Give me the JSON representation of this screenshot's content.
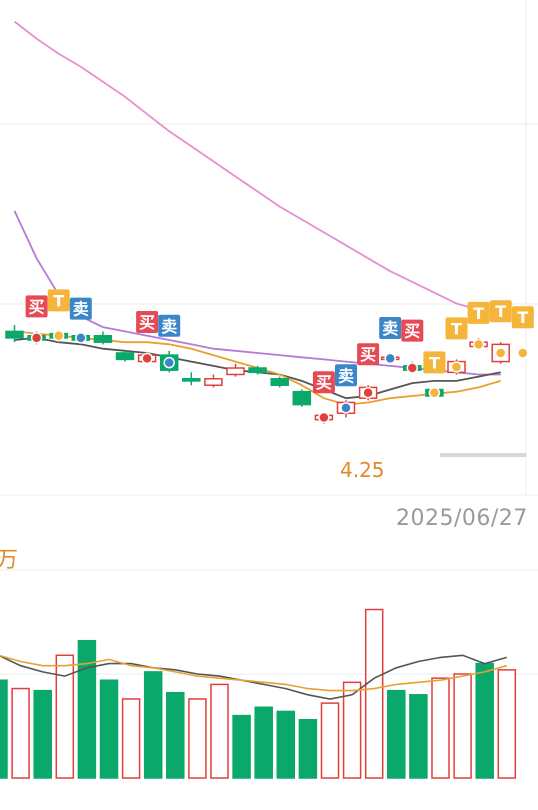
{
  "labels": {
    "date": "2025/06/27",
    "unit": "万",
    "low_price": "4.25",
    "buy_text": "买",
    "sell_text": "卖",
    "t_text": "T"
  },
  "colors": {
    "up": "#e0403c",
    "down": "#0aa86a",
    "ma_pink": "#e58fd0",
    "ma_purple": "#b57ad6",
    "ma_gray": "#555555",
    "ma_orange": "#e8a030",
    "buy_badge": "#e64a55",
    "sell_badge": "#3a86c8",
    "t_badge": "#f5b43a",
    "grid": "#eeeeee"
  },
  "chart_data": [
    {
      "type": "candlestick",
      "y_range": [
        4.1,
        6.4
      ],
      "candles": [
        {
          "o": 4.86,
          "c": 4.83,
          "h": 4.89,
          "l": 4.81
        },
        {
          "o": 4.84,
          "c": 4.82,
          "h": 4.86,
          "l": 4.8
        },
        {
          "o": 4.85,
          "c": 4.83,
          "h": 4.86,
          "l": 4.81
        },
        {
          "o": 4.84,
          "c": 4.82,
          "h": 4.85,
          "l": 4.81
        },
        {
          "o": 4.84,
          "c": 4.81,
          "h": 4.86,
          "l": 4.8
        },
        {
          "o": 4.76,
          "c": 4.73,
          "h": 4.77,
          "l": 4.72
        },
        {
          "o": 4.72,
          "c": 4.75,
          "h": 4.76,
          "l": 4.71
        },
        {
          "o": 4.75,
          "c": 4.68,
          "h": 4.77,
          "l": 4.67
        },
        {
          "o": 4.64,
          "c": 4.63,
          "h": 4.67,
          "l": 4.61
        },
        {
          "o": 4.61,
          "c": 4.64,
          "h": 4.66,
          "l": 4.6
        },
        {
          "o": 4.66,
          "c": 4.69,
          "h": 4.71,
          "l": 4.65
        },
        {
          "o": 4.69,
          "c": 4.67,
          "h": 4.7,
          "l": 4.66
        },
        {
          "o": 4.64,
          "c": 4.61,
          "h": 4.65,
          "l": 4.6
        },
        {
          "o": 4.58,
          "c": 4.52,
          "h": 4.59,
          "l": 4.51
        },
        {
          "o": 4.45,
          "c": 4.47,
          "h": 4.48,
          "l": 4.43
        },
        {
          "o": 4.48,
          "c": 4.53,
          "h": 4.54,
          "l": 4.46
        },
        {
          "o": 4.55,
          "c": 4.6,
          "h": 4.61,
          "l": 4.54
        },
        {
          "o": 4.73,
          "c": 4.74,
          "h": 4.76,
          "l": 4.72
        },
        {
          "o": 4.7,
          "c": 4.68,
          "h": 4.72,
          "l": 4.67
        },
        {
          "o": 4.59,
          "c": 4.56,
          "h": 4.6,
          "l": 4.55
        },
        {
          "o": 4.67,
          "c": 4.72,
          "h": 4.73,
          "l": 4.66
        },
        {
          "o": 4.79,
          "c": 4.81,
          "h": 4.83,
          "l": 4.78
        },
        {
          "o": 4.72,
          "c": 4.8,
          "h": 4.81,
          "l": 4.71
        }
      ],
      "ma_series": [
        {
          "key": "ma_pink",
          "values": [
            6.3,
            6.22,
            6.15,
            6.09,
            6.02,
            5.95,
            5.87,
            5.79,
            5.72,
            5.65,
            5.58,
            5.51,
            5.44,
            5.38,
            5.32,
            5.26,
            5.2,
            5.14,
            5.09,
            5.04,
            4.99,
            4.96,
            4.94
          ]
        },
        {
          "key": "ma_purple",
          "values": [
            5.42,
            5.2,
            5.03,
            4.93,
            4.88,
            4.86,
            4.84,
            4.82,
            4.8,
            4.78,
            4.77,
            4.76,
            4.75,
            4.74,
            4.73,
            4.72,
            4.71,
            4.7,
            4.69,
            4.68,
            4.67,
            4.66,
            4.66
          ]
        },
        {
          "key": "ma_gray",
          "values": [
            4.82,
            4.83,
            4.81,
            4.8,
            4.78,
            4.77,
            4.76,
            4.74,
            4.72,
            4.7,
            4.68,
            4.67,
            4.66,
            4.63,
            4.59,
            4.55,
            4.56,
            4.59,
            4.62,
            4.63,
            4.63,
            4.65,
            4.67
          ]
        },
        {
          "key": "ma_orange",
          "values": [
            4.86,
            4.85,
            4.84,
            4.83,
            4.82,
            4.81,
            4.81,
            4.8,
            4.78,
            4.75,
            4.72,
            4.69,
            4.66,
            4.61,
            4.55,
            4.52,
            4.53,
            4.55,
            4.56,
            4.57,
            4.58,
            4.6,
            4.63
          ]
        }
      ],
      "signals": [
        {
          "i": 1,
          "kind": "buy"
        },
        {
          "i": 2,
          "kind": "t"
        },
        {
          "i": 3,
          "kind": "sell"
        },
        {
          "i": 6,
          "kind": "buy"
        },
        {
          "i": 7,
          "kind": "sell"
        },
        {
          "i": 14,
          "kind": "buy"
        },
        {
          "i": 15,
          "kind": "sell"
        },
        {
          "i": 16,
          "kind": "buy"
        },
        {
          "i": 17,
          "kind": "sell"
        },
        {
          "i": 18,
          "kind": "buy"
        },
        {
          "i": 19,
          "kind": "t"
        },
        {
          "i": 20,
          "kind": "t"
        },
        {
          "i": 21,
          "kind": "t"
        },
        {
          "i": 22,
          "kind": "t"
        },
        {
          "i": 23,
          "kind": "t"
        }
      ]
    },
    {
      "type": "bar",
      "y_range": [
        0,
        100
      ],
      "bars": [
        {
          "v": 47,
          "up": false
        },
        {
          "v": 43,
          "up": true
        },
        {
          "v": 42,
          "up": false
        },
        {
          "v": 59,
          "up": true
        },
        {
          "v": 66,
          "up": false
        },
        {
          "v": 47,
          "up": false
        },
        {
          "v": 38,
          "up": true
        },
        {
          "v": 51,
          "up": false
        },
        {
          "v": 41,
          "up": false
        },
        {
          "v": 38,
          "up": true
        },
        {
          "v": 45,
          "up": true
        },
        {
          "v": 30,
          "up": false
        },
        {
          "v": 34,
          "up": false
        },
        {
          "v": 32,
          "up": false
        },
        {
          "v": 28,
          "up": false
        },
        {
          "v": 36,
          "up": true
        },
        {
          "v": 46,
          "up": true
        },
        {
          "v": 81,
          "up": true
        },
        {
          "v": 42,
          "up": false
        },
        {
          "v": 40,
          "up": false
        },
        {
          "v": 48,
          "up": true
        },
        {
          "v": 50,
          "up": true
        },
        {
          "v": 55,
          "up": false
        },
        {
          "v": 52,
          "up": true
        }
      ],
      "ma_series": [
        {
          "key": "ma_gray",
          "values": [
            59,
            54,
            51,
            49,
            53,
            55,
            55,
            53,
            52,
            50,
            49,
            47,
            45,
            43,
            40,
            38,
            40,
            48,
            53,
            56,
            58,
            59,
            55,
            58
          ]
        },
        {
          "key": "ma_orange",
          "values": [
            59,
            56,
            54,
            54,
            55,
            57,
            54,
            53,
            51,
            49,
            48,
            47,
            46,
            45,
            43,
            42,
            42,
            43,
            45,
            46,
            47,
            49,
            51,
            54
          ]
        }
      ]
    }
  ]
}
